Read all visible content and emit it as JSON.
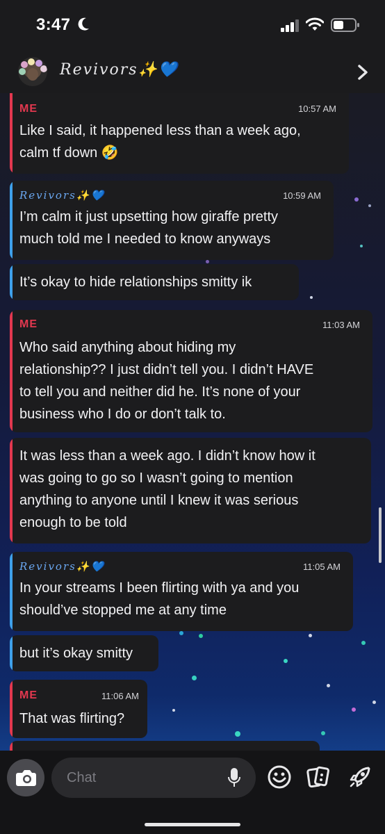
{
  "status_bar": {
    "time": "3:47"
  },
  "header": {
    "title": "Revivors✨💙"
  },
  "messages": [
    {
      "sender": "ME",
      "time": "10:57 AM",
      "text": "Like I said, it happened less than a week ago,\ncalm tf down 🤣"
    },
    {
      "sender": "Revivors✨💙",
      "time": "10:59 AM",
      "text": "I’m calm it just upsetting how giraffe pretty\nmuch told me I needed to know anyways"
    },
    {
      "text": "It’s okay to hide relationships smitty ik"
    },
    {
      "sender": "ME",
      "time": "11:03 AM",
      "text": "Who said anything about hiding my\nrelationship?? I just didn’t tell you. I didn’t HAVE\nto tell you and neither did he. It’s none of your\nbusiness who I do or don’t talk to."
    },
    {
      "text": "It was less than a week ago. I didn’t know how it\nwas going to go so I wasn’t going to mention\nanything to anyone until I knew it was serious\nenough to be told"
    },
    {
      "sender": "Revivors✨💙",
      "time": "11:05 AM",
      "text": "In your streams I been flirting with ya and you\nshould’ve stopped me at any time"
    },
    {
      "text": "but it’s okay smitty"
    },
    {
      "sender": "ME",
      "time": "11:06 AM",
      "text": "That was flirting?"
    }
  ],
  "composer": {
    "placeholder": "Chat"
  },
  "icons": {
    "status": [
      "moon-icon",
      "signal-icon",
      "wifi-icon",
      "battery-icon"
    ],
    "header": [
      "avatar",
      "chevron-right-icon"
    ],
    "composer": [
      "camera-icon",
      "microphone-icon",
      "smiley-icon",
      "sticker-cards-icon",
      "rocket-icon"
    ]
  },
  "colors": {
    "me_accent": "#e2384f",
    "friend_accent": "#3ea0ea",
    "bubble": "#1c1c1e"
  }
}
